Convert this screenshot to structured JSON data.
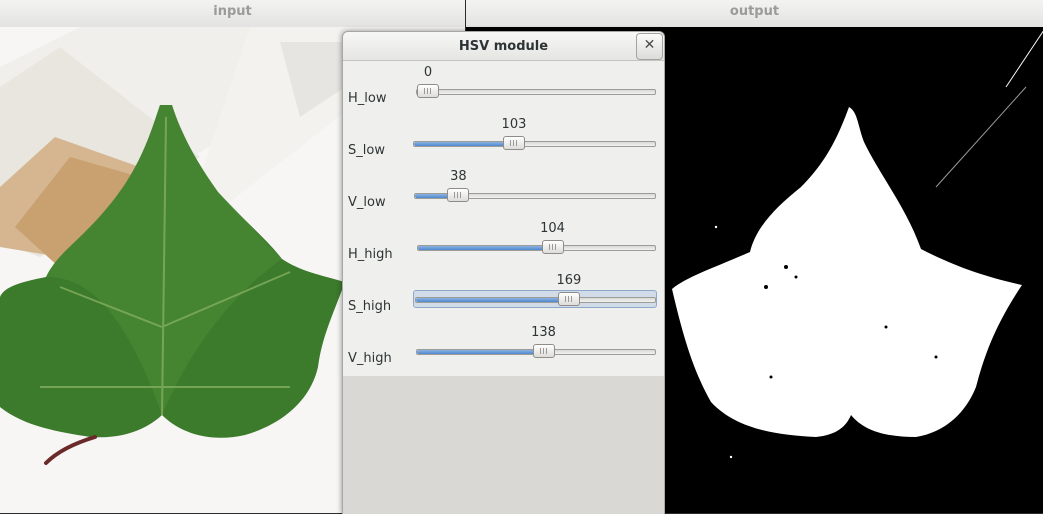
{
  "windows": {
    "input": {
      "title": "input"
    },
    "output": {
      "title": "output"
    }
  },
  "dialog": {
    "title": "HSV module",
    "close_glyph": "✕",
    "sliders": [
      {
        "label": "H_low",
        "value": "0",
        "fraction": 0.0
      },
      {
        "label": "S_low",
        "value": "103",
        "fraction": 0.41
      },
      {
        "label": "V_low",
        "value": "38",
        "fraction": 0.15
      },
      {
        "label": "H_high",
        "value": "104",
        "fraction": 0.58
      },
      {
        "label": "S_high",
        "value": "169",
        "fraction": 0.66
      },
      {
        "label": "V_high",
        "value": "138",
        "fraction": 0.54
      }
    ]
  },
  "colors": {
    "accent": "#4f88cf",
    "leaf": "#3f7d2e"
  }
}
